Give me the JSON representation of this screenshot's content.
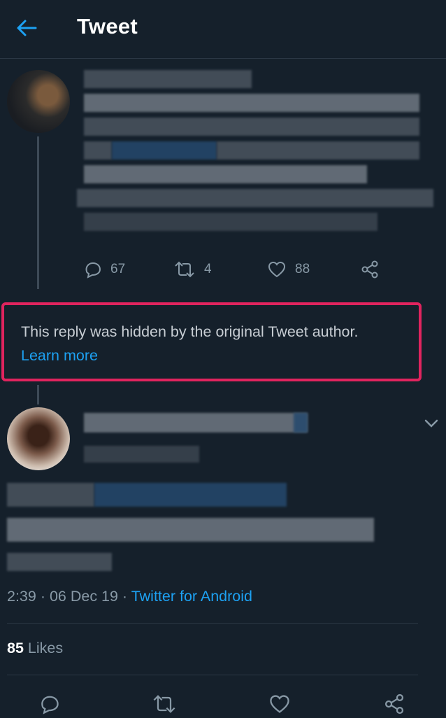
{
  "header": {
    "title": "Tweet",
    "back_icon": "arrow-left-icon"
  },
  "colors": {
    "background": "#15202b",
    "accent": "#1da1f2",
    "highlight_border": "#e0245e",
    "muted": "#8899a6"
  },
  "tweet": {
    "stats": {
      "replies": "67",
      "retweets": "4",
      "likes": "88"
    }
  },
  "hidden_reply": {
    "message": "This reply was hidden by the original Tweet author.",
    "link_label": "Learn more"
  },
  "reply_meta": {
    "time": "2:39 · 06 Dec 19 · ",
    "source": "Twitter for Android"
  },
  "likes": {
    "count": "85",
    "label": " Likes"
  },
  "icons": [
    "arrow-left-icon",
    "reply-icon",
    "retweet-icon",
    "heart-icon",
    "share-icon",
    "chevron-down-icon"
  ]
}
